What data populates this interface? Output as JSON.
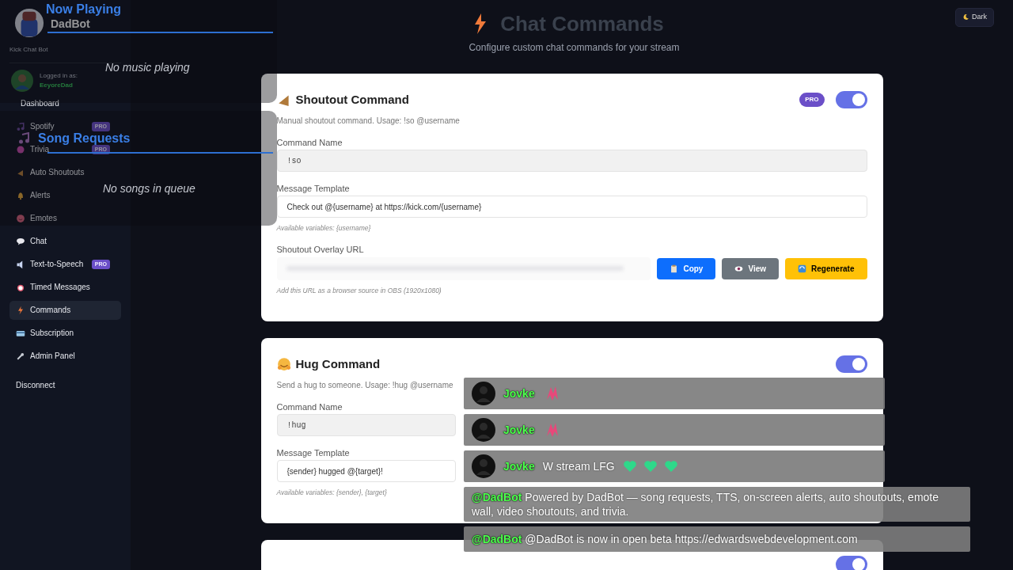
{
  "sidebar": {
    "brand": "DadBot",
    "tagline": "Kick Chat Bot",
    "user": {
      "label": "Logged in as:",
      "name": "EeyoreDad"
    },
    "items": [
      {
        "label": "Dashboard",
        "selected": false
      },
      {
        "label": "Spotify",
        "badge": "PRO",
        "selected": false
      },
      {
        "label": "Trivia",
        "badge": "PRO",
        "selected": false
      },
      {
        "label": "Auto Shoutouts",
        "selected": false
      },
      {
        "label": "Alerts",
        "selected": false
      },
      {
        "label": "Emotes",
        "selected": false
      },
      {
        "label": "Chat",
        "selected": false
      },
      {
        "label": "Text-to-Speech",
        "badge": "PRO",
        "selected": false
      },
      {
        "label": "Timed Messages",
        "selected": false
      },
      {
        "label": "Commands",
        "selected": true
      },
      {
        "label": "Subscription",
        "selected": false
      },
      {
        "label": "Admin Panel",
        "selected": false
      }
    ],
    "disconnect": "Disconnect"
  },
  "header": {
    "title": "Chat Commands",
    "subtitle": "Configure custom chat commands for your stream"
  },
  "theme_button": "Dark",
  "commands": [
    {
      "title": "Shoutout Command",
      "badge": "PRO",
      "enabled": true,
      "description": "Manual shoutout command. Usage: !so @username",
      "fields": [
        {
          "label": "Command Name",
          "value": "!so",
          "disabled": true
        },
        {
          "label": "Message Template",
          "value": "Check out @{username} at https://kick.com/{username}",
          "disabled": false
        }
      ],
      "hint": "Available variables: {username}",
      "overlay_url": {
        "label": "Shoutout Overlay URL",
        "buttons": [
          {
            "label": "Copy",
            "kind": "primary"
          },
          {
            "label": "View",
            "kind": "secondary"
          },
          {
            "label": "Regenerate",
            "kind": "warning"
          }
        ],
        "hint": "Add this URL as a browser source in OBS (1920x1080)"
      }
    },
    {
      "title": "Hug Command",
      "enabled": true,
      "description": "Send a hug to someone. Usage: !hug @username",
      "fields": [
        {
          "label": "Command Name",
          "value": "!hug",
          "disabled": true
        },
        {
          "label": "Message Template",
          "value": "{sender} hugged @{target}!",
          "disabled": false
        }
      ],
      "hint": "Available variables: {sender}, {target}"
    },
    {
      "enabled": true
    }
  ],
  "now_playing": {
    "title": "Now Playing",
    "status": "No music playing"
  },
  "song_requests": {
    "title": "Song Requests",
    "status": "No songs in queue"
  },
  "chat": [
    {
      "kind": "emote",
      "user": "Jovke"
    },
    {
      "kind": "emote",
      "user": "Jovke"
    },
    {
      "kind": "hearts",
      "user": "Jovke",
      "text": "W stream LFG"
    },
    {
      "kind": "bot",
      "user": "@DadBot",
      "text": "Powered by DadBot — song requests, TTS, on-screen alerts, auto shoutouts, emote wall, video shoutouts, and trivia."
    },
    {
      "kind": "bot",
      "user": "@DadBot",
      "text": "@DadBot is now in open beta https://edwardswebdevelopment.com"
    }
  ]
}
